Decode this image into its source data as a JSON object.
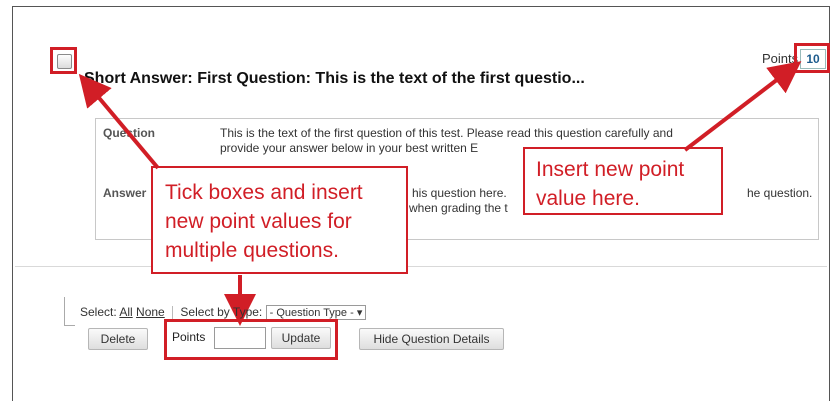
{
  "question": {
    "title": "Short Answer: First Question: This is the text of the first questio...",
    "points_label": "Points",
    "points_value": "10",
    "question_label": "Question",
    "question_text_line1": "This is the text of the first question of this test. Please read this question carefully and",
    "question_text_line2": "provide your answer below in your best written E",
    "answer_label": "Answer",
    "answer_text_line1": "his question here.",
    "answer_text_line1b": "he question.",
    "answer_text_line2": "when grading the t"
  },
  "callouts": {
    "left_line1": "Tick boxes and insert",
    "left_line2": "new point values for",
    "left_line3": "multiple questions.",
    "right_line1": "Insert new point",
    "right_line2": "value here."
  },
  "bulk_controls": {
    "select_label": "Select:",
    "all_link": "All",
    "none_link": "None",
    "select_by_type_label": "Select by Type:",
    "question_type_option": "- Question Type -",
    "delete_button": "Delete",
    "points_label": "Points",
    "points_value": "",
    "update_button": "Update",
    "hide_details_button": "Hide Question Details"
  },
  "colors": {
    "annotation_red": "#d11e26",
    "points_text": "#1c5b8d"
  }
}
